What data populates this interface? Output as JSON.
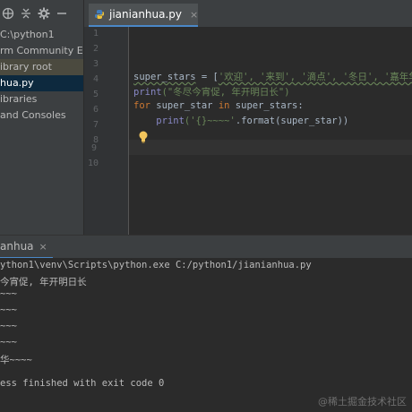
{
  "sidebar": {
    "toolbar_icons": [
      "target-icon",
      "collapse-icon",
      "gear-icon",
      "minimize-icon"
    ],
    "items": [
      {
        "label": "C:\\python1",
        "state": "normal"
      },
      {
        "label": "rm Community Edi",
        "state": "normal"
      },
      {
        "label": "ibrary root",
        "state": "lib"
      },
      {
        "label": "hua.py",
        "state": "selected"
      },
      {
        "label": "ibraries",
        "state": "normal"
      },
      {
        "label": " and Consoles",
        "state": "normal"
      }
    ]
  },
  "editor": {
    "tab_label": "jianianhua.py",
    "tab_close": "×",
    "line_numbers": [
      "1",
      "2",
      "3",
      "4",
      "5",
      "6",
      "7",
      "8",
      "9",
      "10"
    ],
    "code": {
      "l4_var": "super_stars",
      "l4_op": " = [",
      "l4_items": "'欢迎', '来到', '滴点', '冬日', '嘉年华'",
      "l4_end": "]",
      "l5_fn": "print",
      "l5_str": "(\"冬尽今宵促, 年开明日长\")",
      "l6_kw1": "for",
      "l6_var": " super_star ",
      "l6_kw2": "in",
      "l6_rest": " super_stars:",
      "l7_indent": "    ",
      "l7_fn": "print",
      "l7_str": "('{}~~~~'",
      "l7_rest": ".format(super_star))"
    }
  },
  "run_panel": {
    "tab_label": "anhua",
    "tab_close": "×",
    "output": [
      "ython1\\venv\\Scripts\\python.exe C:/python1/jianianhua.py",
      "今宵促, 年开明日长",
      "~~~",
      "~~~",
      "~~~",
      "~~~",
      "华~~~~",
      "",
      "ess finished with exit code 0"
    ],
    "watermark": "@稀土掘金技术社区"
  },
  "colors": {
    "background": "#2b2b2b",
    "panel": "#3c3f41",
    "keyword": "#cc7832",
    "string": "#6a8759",
    "builtin": "#8888c6",
    "accent": "#4a88c7"
  }
}
